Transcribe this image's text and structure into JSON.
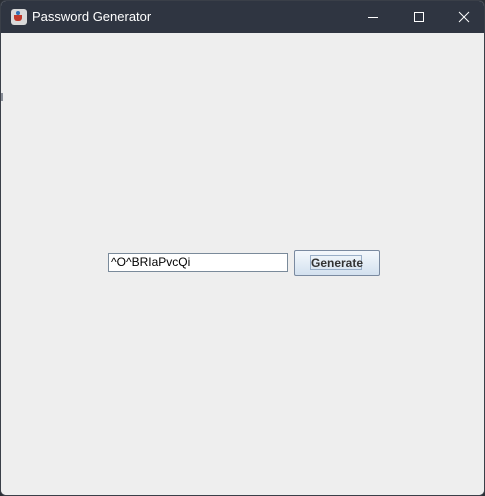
{
  "window": {
    "title": "Password Generator",
    "icon": "java-cup-icon",
    "controls": {
      "minimize_icon": "minimize-icon",
      "maximize_icon": "maximize-icon",
      "close_icon": "close-icon"
    }
  },
  "form": {
    "password_value": "^O^BRIaPvcQi",
    "generate_label": "Generate"
  },
  "colors": {
    "titlebar": "#2f3541",
    "content_background": "#eeeeee",
    "button_top": "#f4f8fc",
    "button_bottom": "#d3e1ef"
  }
}
